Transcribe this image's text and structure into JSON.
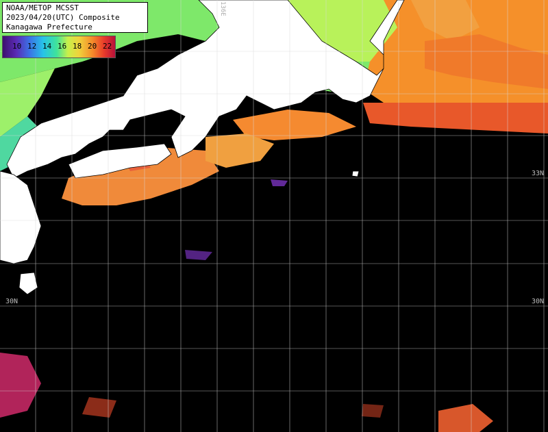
{
  "title": {
    "line1": "NOAA/METOP MCSST",
    "line2": "2023/04/20(UTC) Composite",
    "line3": "Kanagawa Prefecture"
  },
  "colorbar": {
    "labels": [
      "10",
      "12",
      "14",
      "16",
      "18",
      "20",
      "22"
    ]
  },
  "latitude_labels": {
    "lat33": "33N",
    "lat30_left": "30N",
    "lat30_right": "30N"
  },
  "longitude_labels": {
    "lon136": "136E"
  },
  "colors": {
    "land": "#ffffff",
    "ocean_no_data": "#000000",
    "grid": "#d8d8d8",
    "cold_sst": "#5af07a",
    "warm_sst": "#f5902a",
    "hot_sst": "#e8382a"
  }
}
